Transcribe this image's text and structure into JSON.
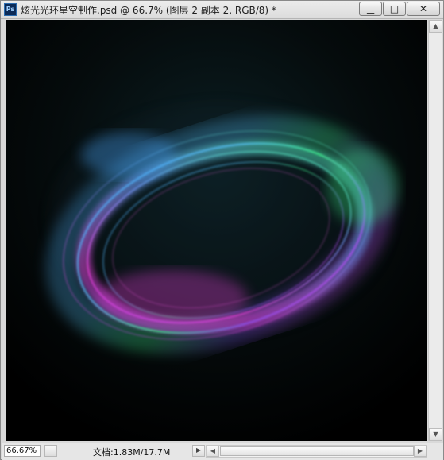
{
  "window": {
    "title": "炫光光环星空制作.psd @ 66.7% (图层 2 副本 2, RGB/8) *",
    "app_icon_text": "Ps",
    "min_label": "▁",
    "max_label": "□",
    "close_label": "✕"
  },
  "status": {
    "zoom": "66.67%",
    "doc_info": "文档:1.83M/17.7M"
  },
  "scroll": {
    "up": "▲",
    "down": "▼",
    "left": "◀",
    "right": "▶"
  },
  "colors": {
    "ring_blue": "#4aa8ff",
    "ring_green": "#40ff90",
    "ring_magenta": "#ff44ee",
    "ring_purple": "#8a57ff"
  }
}
